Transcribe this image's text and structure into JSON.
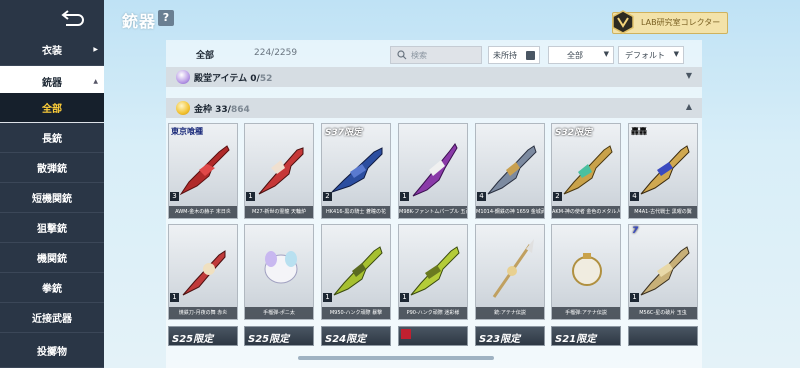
{
  "header": {
    "title": "銃器",
    "help_label": "?",
    "badge_text": "LAB研究室コレクター"
  },
  "sidebar": {
    "items": [
      {
        "label": "衣装"
      },
      {
        "label": "銃器"
      },
      {
        "label": "全部"
      },
      {
        "label": "長銃"
      },
      {
        "label": "散弾銃"
      },
      {
        "label": "短機関銃"
      },
      {
        "label": "狙撃銃"
      },
      {
        "label": "機関銃"
      },
      {
        "label": "拳銃"
      },
      {
        "label": "近接武器"
      },
      {
        "label": "投擲物"
      }
    ]
  },
  "filters": {
    "all_label": "全部",
    "count": "224/2259",
    "search_placeholder": "検索",
    "unowned_label": "未所持",
    "category_select": "全部",
    "sort_select": "デフォルト"
  },
  "sections": [
    {
      "name": "殿堂アイテム",
      "owned": "0/",
      "total": "52",
      "expanded": false
    },
    {
      "name": "金枠",
      "owned": "33/",
      "total": "864",
      "expanded": true
    }
  ],
  "cards_row1": [
    {
      "tag": "東京喰種",
      "stars": "3",
      "name": "AWM-金木の赫子 末日炎"
    },
    {
      "tag": "",
      "stars": "1",
      "name": "M27-新世の霊龍 天輪炉"
    },
    {
      "tag": "S37限定",
      "stars": "2",
      "name": "HK416-黒の騎士 蒼瞳の花"
    },
    {
      "tag": "",
      "stars": "1",
      "name": "M98K-ファントムパープル 五百年"
    },
    {
      "tag": "",
      "stars": "4",
      "name": "M1014-鋼鉄の神 1659 金城武具"
    },
    {
      "tag": "S32限定",
      "stars": "2",
      "name": "AKM-神の使者 金色のメタル人"
    },
    {
      "tag": "轟轟",
      "stars": "4",
      "name": "M4A1-古代戦士 黒曜の翼"
    }
  ],
  "cards_row2": [
    {
      "tag": "",
      "stars": "1",
      "name": "焼鉄刀-月夜の舞 赤炎"
    },
    {
      "tag": "",
      "stars": "",
      "name": "手榴弾-ポニ太"
    },
    {
      "tag": "",
      "stars": "1",
      "name": "M950-ハンク頑際 暴撃"
    },
    {
      "tag": "",
      "stars": "1",
      "name": "P90-ハンク頑際 迷彩様"
    },
    {
      "tag": "",
      "stars": "",
      "name": "銃:アテナ伝説"
    },
    {
      "tag": "",
      "stars": "",
      "name": "手榴弾:アテナ伝説"
    },
    {
      "tag": "7",
      "stars": "1",
      "name": "M56C-星の破片 玉虫"
    }
  ],
  "cards_row3": [
    {
      "tag": "S25限定"
    },
    {
      "tag": "S25限定"
    },
    {
      "tag": "S24限定"
    },
    {
      "tag": ""
    },
    {
      "tag": "S23限定"
    },
    {
      "tag": "S21限定"
    },
    {
      "tag": ""
    }
  ],
  "colors": {
    "accent": "#ffcf3a",
    "sidebar_dark": "#2a3646",
    "section_bg": "#d6dde3"
  }
}
